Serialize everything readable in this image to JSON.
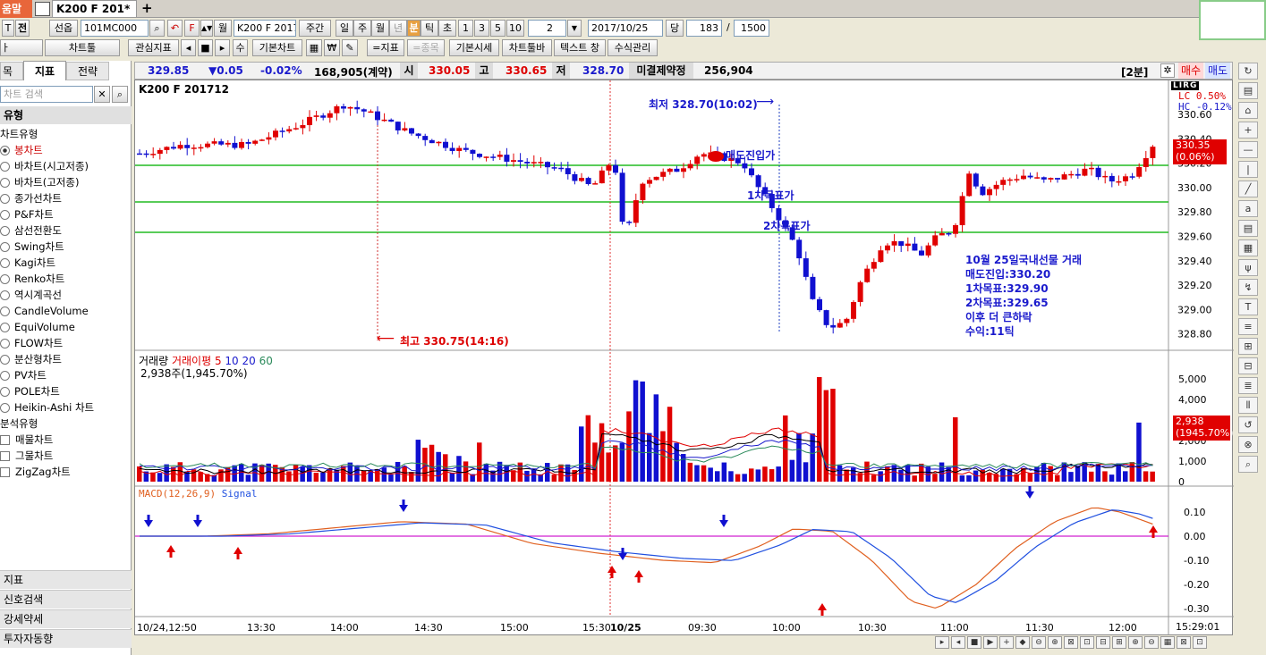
{
  "topbar": {
    "menu_tab": "움말",
    "tab_title": "K200 F 201*",
    "add_tab": "+"
  },
  "toolbar1": {
    "code": "101MC000",
    "name_box": "K200 F 2017",
    "period_week": "주간",
    "p_day": "일",
    "p_week": "주",
    "p_month": "월",
    "p_year": "년",
    "p_min": "분",
    "p_tick": "틱",
    "p_sec": "초",
    "n1": "1",
    "n3": "3",
    "n5": "5",
    "n10": "10",
    "interval": "2",
    "date": "2017/10/25",
    "dang": "당",
    "count": "183",
    "slash": "/",
    "total": "1500",
    "t_label": "전",
    "sel_label": "선옵",
    "month_label": "월"
  },
  "toolbar2": {
    "chart_tools": "차트툴",
    "interest": "관심지표",
    "su": "수",
    "basic_chart": "기본차트",
    "indicator": "=지표",
    "item": "=종목",
    "basic_quote": "기본시세",
    "chart_toolbar": "차트툴바",
    "text_window": "텍스트 창",
    "formula": "수식관리",
    "won": "₩"
  },
  "left": {
    "tab_item": "목",
    "tab_indicator": "지표",
    "tab_strategy": "전략",
    "search_placeholder": "차트 검색",
    "section_type": "유형",
    "chart_type_label": "차트유형",
    "chart_types": [
      "봉차트",
      "바차트(시고저종)",
      "바차트(고저종)",
      "종가선차트",
      "P&F차트",
      "삼선전환도",
      "Swing차트",
      "Kagi차트",
      "Renko차트",
      "역시계곡선",
      "CandleVolume",
      "EquiVolume",
      "FLOW차트",
      "분산형차트",
      "PV차트",
      "POLE차트",
      "Heikin-Ashi 차트"
    ],
    "analysis_label": "분석유형",
    "analysis_types": [
      "매물차트",
      "그물차트",
      "ZigZag차트"
    ],
    "bottom_sections": [
      "지표",
      "신호검색",
      "강세약세",
      "투자자동향"
    ]
  },
  "infobar": {
    "price": "329.85",
    "change": "▼0.05",
    "pct": "-0.02%",
    "volume": "168,905(계약)",
    "open_l": "시",
    "open": "330.05",
    "high_l": "고",
    "high": "330.65",
    "low_l": "저",
    "low": "328.70",
    "oi_l": "미결제약정",
    "oi": "256,904",
    "interval": "[2분]",
    "buy": "매수",
    "sell": "매도"
  },
  "chart": {
    "title": "K200 F 201712",
    "lc": "LC  0.50%",
    "hc": "HC -0.12%",
    "lirg": "LIRG",
    "price_axis": [
      "330.60",
      "330.40",
      "330.20",
      "330.00",
      "329.80",
      "329.60",
      "329.40",
      "329.20",
      "329.00",
      "328.80"
    ],
    "cur_price": "330.35",
    "cur_pct": "(0.06%)",
    "low_label": "최저  328.70(10:02)",
    "high_label": "최고  330.75(14:16)",
    "sell_entry": "매도진입가",
    "target1": "1차목표가",
    "target2": "2차목표가",
    "note": [
      "10월 25일국내선물 거래",
      "매도진입:330.20",
      "1차목표:329.90",
      "2차목표:329.65",
      "이후 더 큰하락",
      "수익:11틱"
    ],
    "vol_title": "거래량",
    "vol_ma": "거래이평",
    "vol_ma_periods": [
      "5",
      "10",
      "20",
      "60"
    ],
    "vol_value": "2,938주(1,945.70%)",
    "vol_axis": [
      "5,000",
      "4,000",
      "3,000",
      "2,000",
      "1,000",
      "0"
    ],
    "vol_cur": "2,938",
    "vol_cur_pct": "(1945.70%)",
    "macd_title": "MACD(12,26,9)",
    "macd_signal": "Signal",
    "macd_axis": [
      "0.10",
      "0.00",
      "-0.10",
      "-0.20",
      "-0.30"
    ],
    "time_axis": [
      "10/24,12:50",
      "13:30",
      "14:00",
      "14:30",
      "15:00",
      "15:30",
      "10/25",
      "09:30",
      "10:00",
      "10:30",
      "11:00",
      "11:30",
      "12:00"
    ],
    "time_cur": "15:29:01"
  },
  "colors": {
    "up": "#e00000",
    "down": "#1010d0",
    "hline": "#22bb22",
    "macd": "#e06020",
    "signal": "#2050e0"
  }
}
